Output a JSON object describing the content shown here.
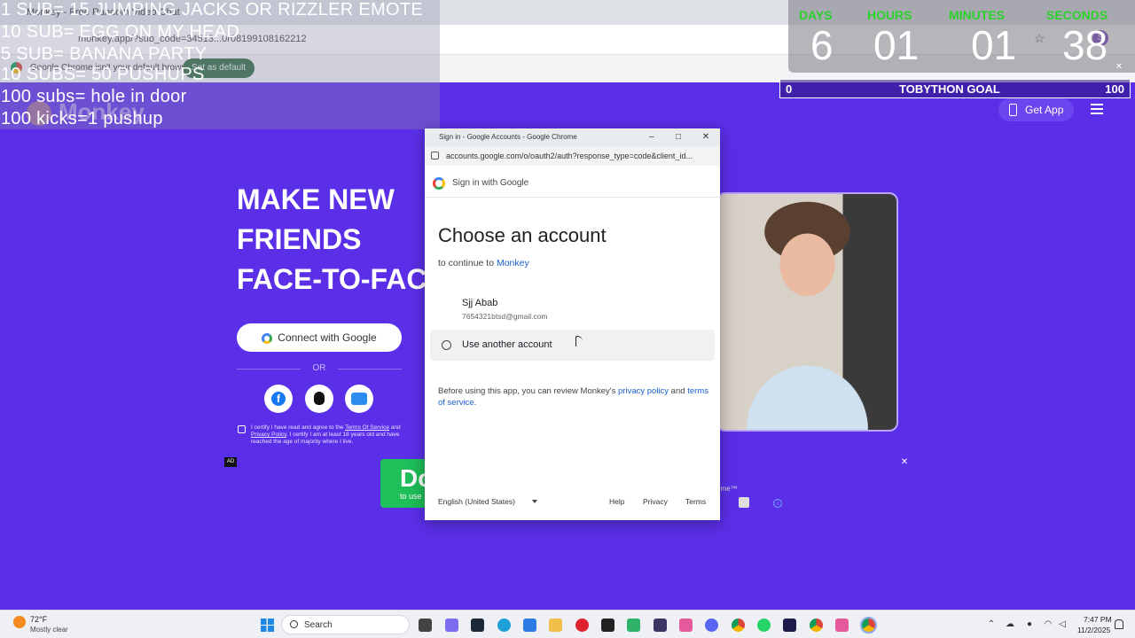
{
  "browser": {
    "tab_title": "Monkey - Free Random Video Chat",
    "address": "monkey.app/?sub_code=34513...0r08199108162212",
    "infobar_text": "Google Chrome isn't your default browser",
    "infobar_button": "Set as default"
  },
  "stream_overlay": {
    "goals": [
      "1 SUB= 15 JUMPING JACKS OR RIZZLER EMOTE",
      "10 SUB= EGG ON MY HEAD",
      "5 SUB= BANANA  PARTY",
      "10 SUBS= 50 PUSHUPS",
      "100 subs= hole in door",
      "100 kicks=1 pushup"
    ],
    "timer": {
      "days_label": "DAYS",
      "hours_label": "HOURS",
      "minutes_label": "MINUTES",
      "seconds_label": "SECONDS",
      "days": "6",
      "hours": "01",
      "minutes": "01",
      "seconds": "38"
    },
    "goal_bar": {
      "min": "0",
      "label": "TOBYTHON GOAL",
      "max": "100"
    }
  },
  "monkey_page": {
    "logo_text": "Monkey",
    "get_app": "Get App",
    "hero_lines": [
      "MAKE NEW",
      "FRIENDS",
      "FACE-TO-FACE"
    ],
    "connect_google": "Connect with Google",
    "or": "OR",
    "terms_prefix": "I certify I have read and agree to the ",
    "terms_link1": "Terms Of Service",
    "terms_and": " and ",
    "terms_link2": "Privacy Policy",
    "terms_suffix": ". I certify I am at least 18 years old and have reached the age of majority where I live.",
    "ad_badge": "AD",
    "ad_button_big": "Do",
    "ad_button_small": "to use",
    "ad_tail_text": "ome™"
  },
  "popup": {
    "window_title": "Sign in - Google Accounts - Google Chrome",
    "url": "accounts.google.com/o/oauth2/auth?response_type=code&client_id...",
    "header_text": "Sign in with Google",
    "title": "Choose an account",
    "continue_prefix": "to continue to ",
    "continue_app": "Monkey",
    "account_name": "Sjj Abab",
    "account_email": "7654321btsd@gmail.com",
    "use_another": "Use another account",
    "policy_prefix": "Before using this app, you can review Monkey's ",
    "privacy_policy": "privacy policy",
    "policy_and": " and ",
    "terms_of_service": "terms of service",
    "policy_end": ".",
    "language": "English (United States)",
    "help": "Help",
    "privacy": "Privacy",
    "terms": "Terms"
  },
  "taskbar": {
    "temperature": "72°F",
    "weather": "Mostly clear",
    "search": "Search",
    "time": "7:47 PM",
    "date": "11/2/2025"
  }
}
